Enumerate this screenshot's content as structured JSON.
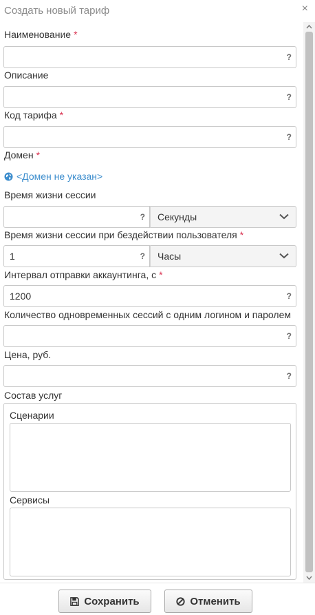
{
  "dialog": {
    "title": "Создать новый тариф",
    "close_glyph": "×"
  },
  "required_mark": "*",
  "help_glyph": "?",
  "fields": {
    "name": {
      "label": "Наименование",
      "value": "",
      "required": true
    },
    "description": {
      "label": "Описание",
      "value": "",
      "required": false
    },
    "code": {
      "label": "Код тарифа",
      "value": "",
      "required": true
    },
    "domain": {
      "label": "Домен",
      "required": true,
      "link_text": "<Домен не указан>",
      "icon": "globe-icon"
    },
    "session_lifetime": {
      "label": "Время жизни сессии",
      "value": "",
      "unit": "Секунды",
      "required": false
    },
    "idle_lifetime": {
      "label": "Время жизни сессии при бездействии пользователя",
      "value": "1",
      "unit": "Часы",
      "required": true
    },
    "accounting_interval": {
      "label": "Интервал отправки аккаунтинга, с",
      "value": "1200",
      "required": true
    },
    "concurrent_sessions": {
      "label": "Количество одновременных сессий с одним логином и паролем",
      "value": "",
      "required": false
    },
    "price": {
      "label": "Цена, руб.",
      "value": "",
      "required": false
    }
  },
  "services": {
    "label": "Состав услуг",
    "scenarios_label": "Сценарии",
    "services_label": "Сервисы"
  },
  "footer": {
    "save_label": "Сохранить",
    "cancel_label": "Отменить"
  },
  "colors": {
    "required": "#d9304f",
    "link": "#3c8dcd",
    "border": "#c8c8c8"
  }
}
